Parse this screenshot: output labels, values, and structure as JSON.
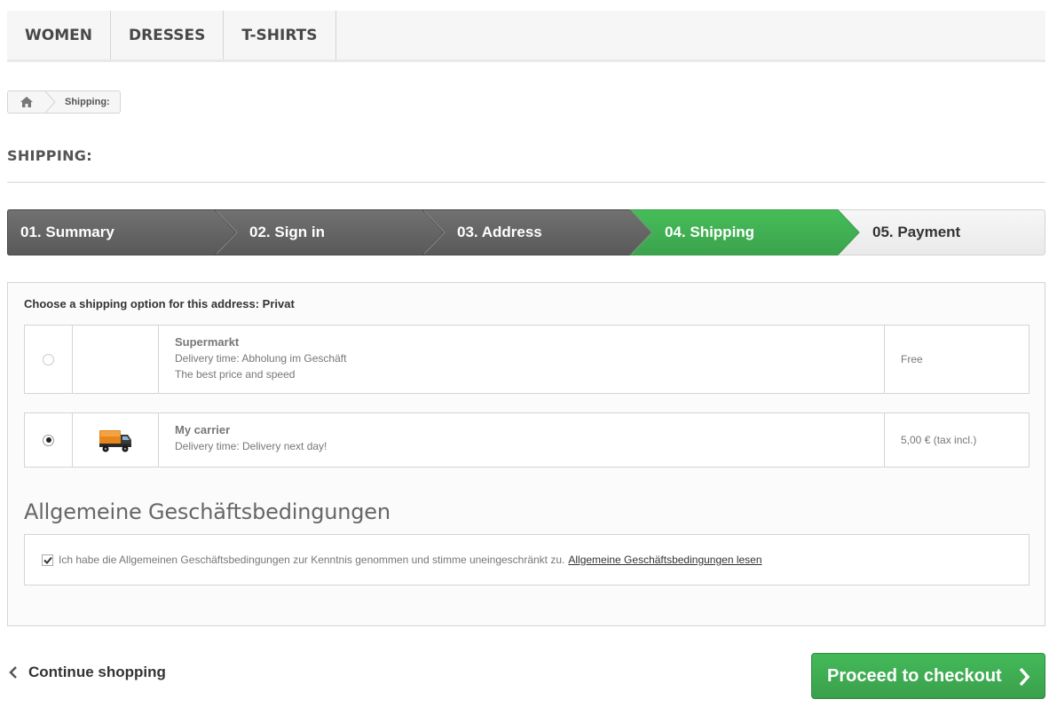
{
  "topmenu": {
    "items": [
      "WOMEN",
      "DRESSES",
      "T-SHIRTS"
    ]
  },
  "breadcrumb": {
    "current": "Shipping:"
  },
  "page": {
    "heading": "SHIPPING:"
  },
  "steps": [
    {
      "label": "01. Summary",
      "state": "done"
    },
    {
      "label": "02. Sign in",
      "state": "done"
    },
    {
      "label": "03. Address",
      "state": "done"
    },
    {
      "label": "04. Shipping",
      "state": "current"
    },
    {
      "label": "05. Payment",
      "state": "todo"
    }
  ],
  "colors": {
    "step_done": "#666666",
    "step_current": "#43b754",
    "step_todo": "#f3f3f3",
    "proceed": "#43b754"
  },
  "delivery": {
    "choose_label": "Choose a shipping option for this address: Privat",
    "options": [
      {
        "name": "Supermarkt",
        "delay": "Delivery time: Abholung im Geschäft",
        "extra": "The best price and speed",
        "price": "Free",
        "selected": false,
        "logo": ""
      },
      {
        "name": "My carrier",
        "delay": "Delivery time: Delivery next day!",
        "extra": "",
        "price": "5,00 € (tax incl.)",
        "selected": true,
        "logo": "truck-icon"
      }
    ]
  },
  "terms": {
    "title": "Allgemeine Geschäftsbedingungen",
    "text": "Ich habe die Allgemeinen Geschäftsbedingungen zur Kenntnis genommen und stimme uneingeschränkt zu.",
    "link": "Allgemeine Geschäftsbedingungen lesen",
    "checked": true
  },
  "nav": {
    "continue": "Continue shopping",
    "proceed": "Proceed to checkout"
  }
}
